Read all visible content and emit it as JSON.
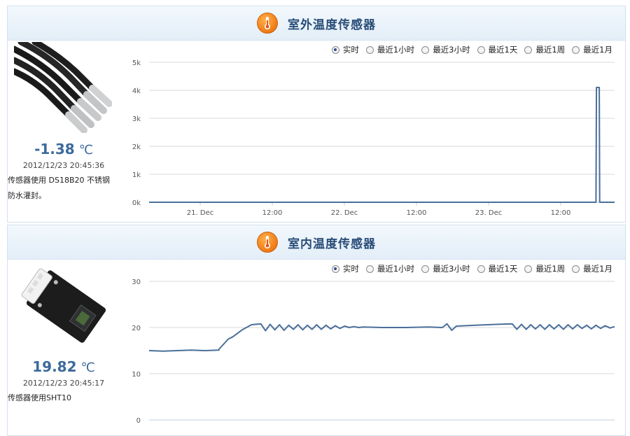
{
  "accent_color": "#3c6a9c",
  "line_color": "#4a6f99",
  "panels": [
    {
      "title": "室外温度传感器",
      "icon": "thermometer-icon",
      "temperature": "-1.38",
      "unit": "℃",
      "timestamp": "2012/12/23 20:45:36",
      "description_line1": "传感器使用  DS18B20  不锈钢",
      "description_line2": "防水灌封。",
      "image": "stainless-probe-cables-photo",
      "range_options": [
        "实时",
        "最近1小时",
        "最近3小时",
        "最近1天",
        "最近1周",
        "最近1月"
      ],
      "selected_range": "实时"
    },
    {
      "title": "室内温度传感器",
      "icon": "thermometer-icon",
      "temperature": "19.82",
      "unit": "℃",
      "timestamp": "2012/12/23 20:45:17",
      "description_line1": "传感器使用SHT10",
      "description_line2": "",
      "image": "sht10-sensor-board-photo",
      "range_options": [
        "实时",
        "最近1小时",
        "最近3小时",
        "最近1天",
        "最近1周",
        "最近1月"
      ],
      "selected_range": "实时"
    }
  ],
  "chart_data": [
    {
      "type": "line",
      "title": "",
      "xlabel": "",
      "ylabel": "",
      "x_tick_labels": [
        "21. Dec",
        "12:00",
        "22. Dec",
        "12:00",
        "23. Dec",
        "12:00"
      ],
      "y_tick_labels": [
        "0k",
        "1k",
        "2k",
        "3k",
        "4k",
        "5k"
      ],
      "ylim": [
        0,
        5000
      ],
      "xlim": [
        0,
        1
      ],
      "grid": true,
      "series": [
        {
          "values_x": [
            0,
            0.96,
            0.961,
            0.967,
            0.968,
            1.0
          ],
          "values_y": [
            0,
            0,
            4100,
            4100,
            0,
            0
          ]
        }
      ]
    },
    {
      "type": "line",
      "title": "",
      "xlabel": "",
      "ylabel": "",
      "x_tick_labels": [],
      "y_tick_labels": [
        "0",
        "10",
        "20",
        "30"
      ],
      "ylim": [
        0,
        30
      ],
      "xlim": [
        0,
        1
      ],
      "grid": true,
      "series": [
        {
          "values_x": [
            0,
            0.03,
            0.06,
            0.09,
            0.12,
            0.15,
            0.15,
            0.17,
            0.18,
            0.2,
            0.22,
            0.24,
            0.25,
            0.26,
            0.27,
            0.28,
            0.29,
            0.3,
            0.31,
            0.32,
            0.33,
            0.34,
            0.35,
            0.36,
            0.37,
            0.38,
            0.39,
            0.4,
            0.41,
            0.42,
            0.43,
            0.44,
            0.45,
            0.46,
            0.5,
            0.55,
            0.6,
            0.63,
            0.64,
            0.65,
            0.66,
            0.7,
            0.75,
            0.78,
            0.79,
            0.8,
            0.81,
            0.82,
            0.83,
            0.84,
            0.85,
            0.86,
            0.87,
            0.88,
            0.89,
            0.9,
            0.91,
            0.92,
            0.93,
            0.94,
            0.95,
            0.96,
            0.97,
            0.98,
            0.99,
            1.0
          ],
          "values_y": [
            15,
            14.9,
            15,
            15.1,
            15,
            15.1,
            15.3,
            17.5,
            18,
            19.5,
            20.6,
            20.8,
            19.3,
            20.7,
            19.5,
            20.6,
            19.4,
            20.5,
            19.6,
            20.6,
            19.5,
            20.5,
            19.6,
            20.6,
            19.6,
            20.5,
            19.7,
            20.4,
            19.8,
            20.3,
            20.0,
            20.2,
            20.0,
            20.1,
            20.0,
            20.0,
            20.1,
            20.0,
            20.8,
            19.4,
            20.3,
            20.5,
            20.7,
            20.8,
            19.6,
            20.7,
            19.6,
            20.6,
            19.7,
            20.6,
            19.6,
            20.6,
            19.7,
            20.6,
            19.6,
            20.6,
            19.7,
            20.6,
            19.8,
            20.5,
            19.7,
            20.5,
            19.8,
            20.4,
            19.9,
            20.2
          ]
        }
      ]
    }
  ]
}
